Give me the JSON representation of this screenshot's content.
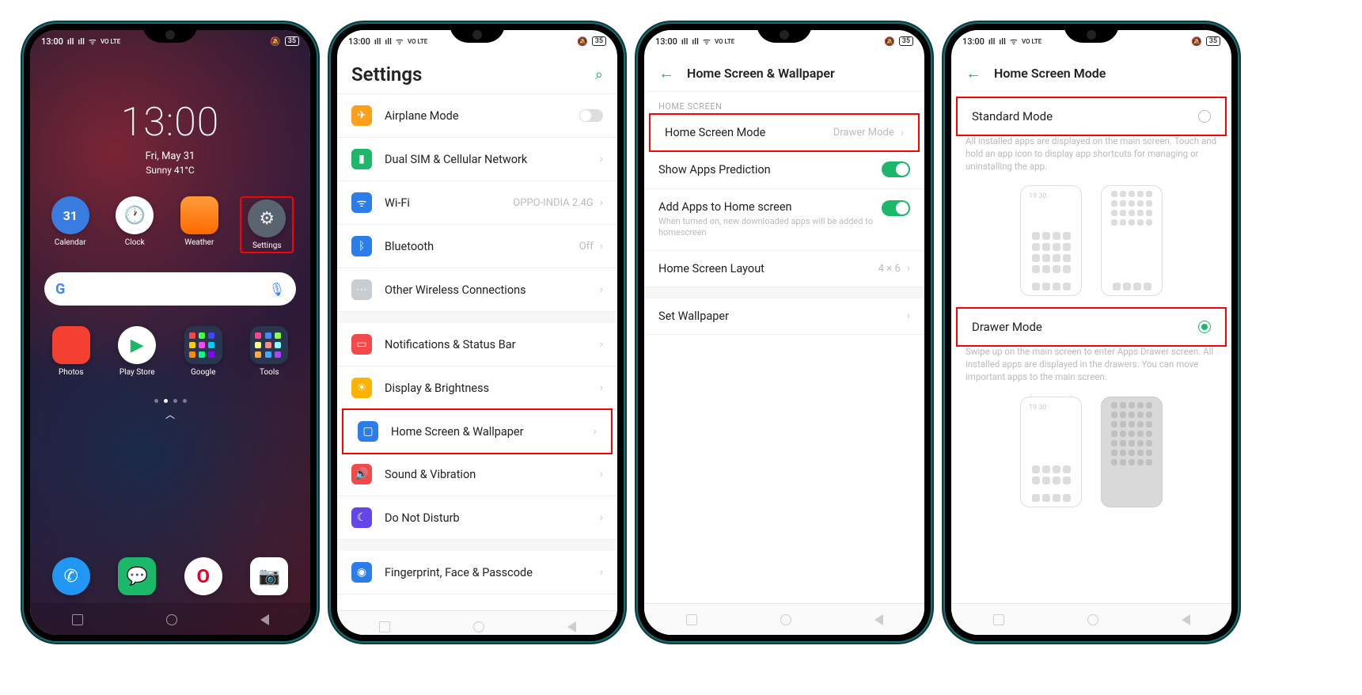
{
  "status": {
    "time": "13:00",
    "volte": "VO LTE",
    "battery": "35"
  },
  "phone1": {
    "clock": "13:00",
    "date": "Fri, May 31",
    "weather": "Sunny 41°C",
    "apps_row1": [
      {
        "name": "Calendar"
      },
      {
        "name": "Clock"
      },
      {
        "name": "Weather"
      },
      {
        "name": "Settings"
      }
    ],
    "apps_row2": [
      {
        "name": "Photos"
      },
      {
        "name": "Play Store"
      },
      {
        "name": "Google"
      },
      {
        "name": "Tools"
      }
    ],
    "calendar_day": "31"
  },
  "phone2": {
    "title": "Settings",
    "items": [
      {
        "label": "Airplane Mode"
      },
      {
        "label": "Dual SIM & Cellular Network"
      },
      {
        "label": "Wi-Fi",
        "value": "OPPO-INDIA 2.4G"
      },
      {
        "label": "Bluetooth",
        "value": "Off"
      },
      {
        "label": "Other Wireless Connections"
      },
      {
        "label": "Notifications & Status Bar"
      },
      {
        "label": "Display & Brightness"
      },
      {
        "label": "Home Screen & Wallpaper"
      },
      {
        "label": "Sound & Vibration"
      },
      {
        "label": "Do Not Disturb"
      },
      {
        "label": "Fingerprint, Face & Passcode"
      }
    ]
  },
  "phone3": {
    "title": "Home Screen & Wallpaper",
    "section": "HOME SCREEN",
    "items": {
      "mode": {
        "label": "Home Screen Mode",
        "value": "Drawer Mode"
      },
      "prediction": {
        "label": "Show Apps Prediction"
      },
      "addapps": {
        "label": "Add Apps to Home screen",
        "sub": "When turned on, new downloaded apps will be added to homescreen"
      },
      "layout": {
        "label": "Home Screen Layout",
        "value": "4 × 6"
      },
      "wallpaper": {
        "label": "Set Wallpaper"
      }
    }
  },
  "phone4": {
    "title": "Home Screen Mode",
    "standard": {
      "label": "Standard Mode",
      "desc": "All installed apps are displayed on the main screen. Touch and hold an app icon to display app shortcuts for managing or uninstalling the app."
    },
    "drawer": {
      "label": "Drawer Mode",
      "desc": "Swipe up on the main screen to enter Apps Drawer screen. All installed apps are displayed in the drawers. You can move important apps to the main screen."
    },
    "illus_clock": "19\n30"
  }
}
